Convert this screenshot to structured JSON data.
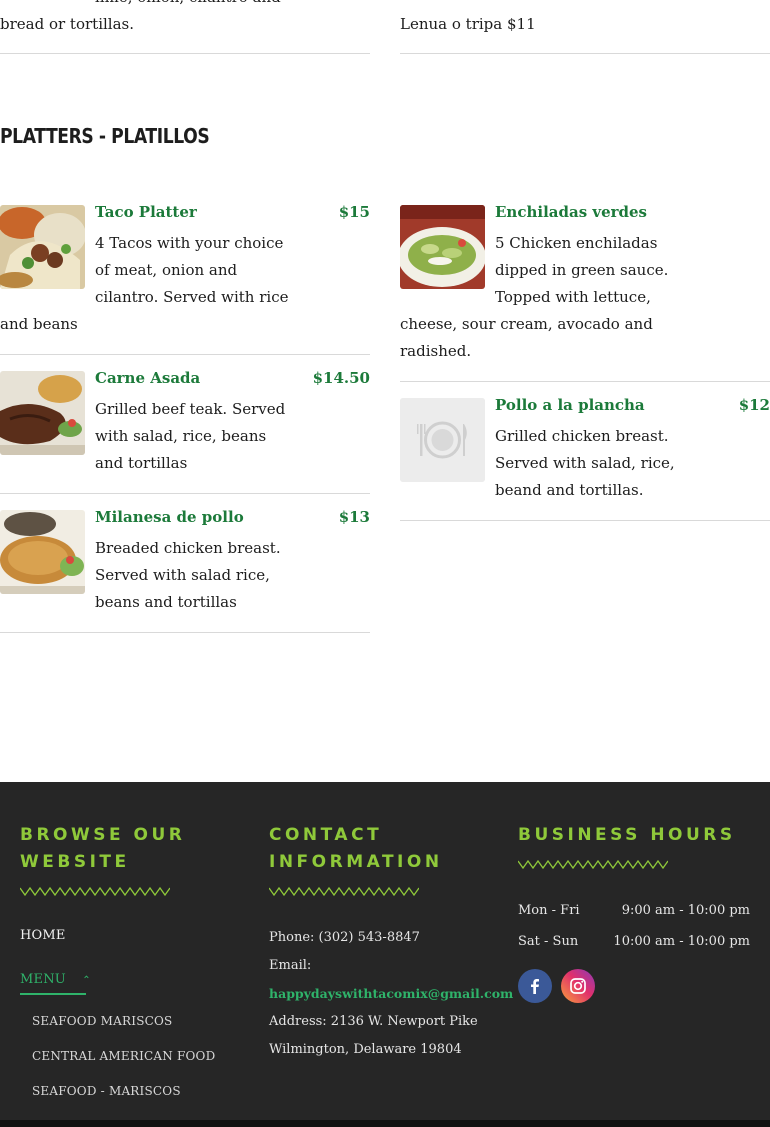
{
  "top_items": {
    "left_line1": "lime, onion, cilantro and",
    "left_line2": "bread or tortillas.",
    "right_line": "Lenua o tripa $11"
  },
  "section": {
    "title": "PLATTERS - PLATILLOS"
  },
  "menu_items": [
    {
      "name": "Taco Platter",
      "price": "$15",
      "description": "4 Tacos with your choice of meat, onion and cilantro. Served with rice and beans",
      "image": "taco-platter-photo"
    },
    {
      "name": "Enchiladas verdes",
      "price": "",
      "description": "5 Chicken enchiladas dipped in green sauce. Topped with lettuce, cheese, sour cream, avocado and radished.",
      "image": "enchiladas-photo"
    },
    {
      "name": "Carne Asada",
      "price": "$14.50",
      "description": "Grilled beef teak. Served with salad, rice, beans and tortillas",
      "image": "carne-asada-photo"
    },
    {
      "name": "Pollo a la plancha",
      "price": "$12",
      "description": "Grilled chicken breast. Served with salad, rice, beand and tortillas.",
      "image": "plate-placeholder-icon"
    },
    {
      "name": "Milanesa de pollo",
      "price": "$13",
      "description": "Breaded chicken breast. Served with salad rice, beans and tortillas",
      "image": "milanesa-photo"
    }
  ],
  "footer": {
    "browse": {
      "heading_line1": "BROWSE OUR",
      "heading_line2": "WEBSITE",
      "links": {
        "home": "HOME",
        "menu": "MENU",
        "sub1": "SEAFOOD MARISCOS",
        "sub2": "CENTRAL AMERICAN FOOD",
        "sub3": "SEAFOOD - MARISCOS"
      }
    },
    "contact": {
      "heading_line1": "CONTACT",
      "heading_line2": "INFORMATION",
      "phone": "Phone: (302) 543-8847",
      "email_label": "Email:",
      "email": "happydayswithtacomix@gmail.com",
      "address": "Address: 2136 W. Newport Pike",
      "city": "Wilmington, Delaware 19804"
    },
    "hours": {
      "heading": "BUSINESS HOURS",
      "rows": [
        {
          "days": "Mon - Fri",
          "time": "9:00 am - 10:00 pm"
        },
        {
          "days": "Sat - Sun",
          "time": "10:00 am - 10:00 pm"
        }
      ]
    },
    "social": {
      "facebook": "facebook-icon",
      "instagram": "instagram-icon"
    }
  },
  "colors": {
    "accent_green": "#1c7a3a",
    "footer_heading": "#8fc93a",
    "footer_link_active": "#2fb36a",
    "footer_bg": "#262626"
  }
}
